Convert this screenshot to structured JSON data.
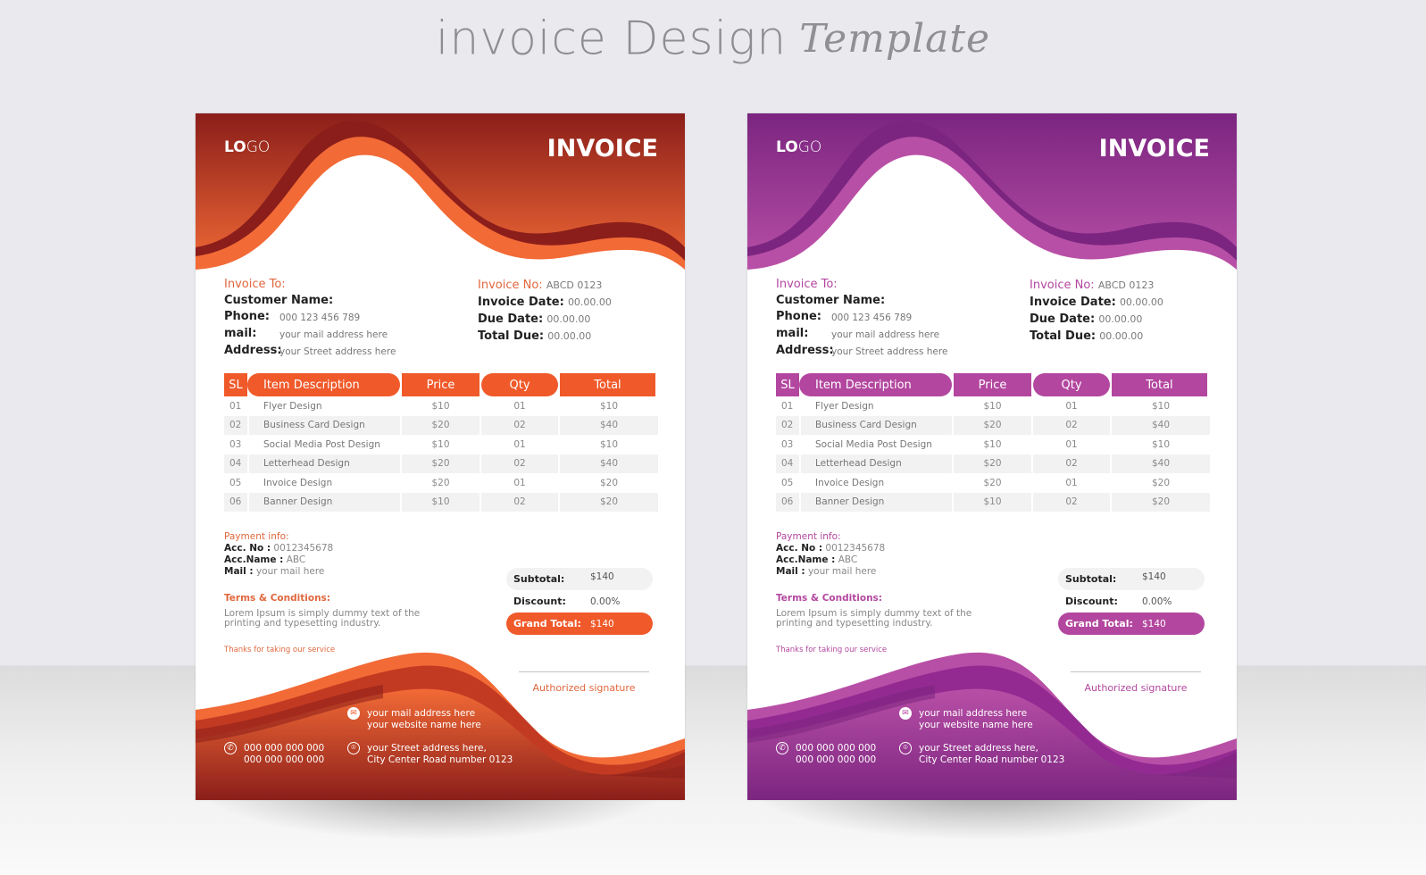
{
  "page_title": {
    "main": "invoice Design",
    "script": "Template"
  },
  "invoices": [
    {
      "theme": "orange",
      "colors": {
        "accent": "#f05a2a",
        "dark": "#8b1e1a",
        "mid": "#c33a22",
        "light": "#f26a36",
        "label": "#e0673d"
      },
      "logo": {
        "bold": "LO",
        "light": "GO"
      },
      "title": "INVOICE",
      "bill_to": {
        "header": "Invoice To:",
        "customer_label": "Customer Name:",
        "phone_label": "Phone:",
        "phone_value": "000 123 456 789",
        "mail_label": "mail:",
        "mail_value": "your mail address here",
        "address_label": "Address:",
        "address_value": "your Street address here"
      },
      "meta": {
        "invoice_no_label": "Invoice No:",
        "invoice_no_value": "ABCD 0123",
        "invoice_date_label": "Invoice Date:",
        "invoice_date_value": "00.00.00",
        "due_date_label": "Due Date:",
        "due_date_value": "00.00.00",
        "total_due_label": "Total Due:",
        "total_due_value": "00.00.00"
      },
      "table": {
        "headers": [
          "SL",
          "Item Description",
          "Price",
          "Qty",
          "Total"
        ],
        "rows": [
          [
            "01",
            "Flyer Design",
            "$10",
            "01",
            "$10"
          ],
          [
            "02",
            "Business Card Design",
            "$20",
            "02",
            "$40"
          ],
          [
            "03",
            "Social Media Post Design",
            "$10",
            "01",
            "$10"
          ],
          [
            "04",
            "Letterhead Design",
            "$20",
            "02",
            "$40"
          ],
          [
            "05",
            "Invoice Design",
            "$20",
            "01",
            "$20"
          ],
          [
            "06",
            "Banner Design",
            "$10",
            "02",
            "$20"
          ]
        ]
      },
      "payment": {
        "header": "Payment info:",
        "acc_no_label": "Acc. No :",
        "acc_no_value": "0012345678",
        "acc_name_label": "Acc.Name :",
        "acc_name_value": "ABC",
        "mail_label": "Mail :",
        "mail_value": "your mail here"
      },
      "terms": {
        "header": "Terms & Conditions:",
        "body": "Lorem Ipsum is simply dummy text of the printing and typesetting industry."
      },
      "thanks": "Thanks for taking our service",
      "totals": {
        "subtotal_label": "Subtotal:",
        "subtotal_value": "$140",
        "discount_label": "Discount:",
        "discount_value": "0.00%",
        "grand_label": "Grand Total:",
        "grand_value": "$140"
      },
      "signature": "Authorized signature",
      "footer": {
        "mail": "your mail address here",
        "website": "your website name here",
        "phone1": "000 000 000 000",
        "phone2": "000 000 000 000",
        "address1": "your Street address here,",
        "address2": "City Center Road number 0123"
      }
    },
    {
      "theme": "purple",
      "colors": {
        "accent": "#b3479f",
        "dark": "#7b2580",
        "mid": "#932a92",
        "light": "#b84fa6",
        "label": "#b3479f"
      },
      "logo": {
        "bold": "LO",
        "light": "GO"
      },
      "title": "INVOICE",
      "bill_to": {
        "header": "Invoice To:",
        "customer_label": "Customer Name:",
        "phone_label": "Phone:",
        "phone_value": "000 123 456 789",
        "mail_label": "mail:",
        "mail_value": "your mail address here",
        "address_label": "Address:",
        "address_value": "your Street address here"
      },
      "meta": {
        "invoice_no_label": "Invoice No:",
        "invoice_no_value": "ABCD 0123",
        "invoice_date_label": "Invoice Date:",
        "invoice_date_value": "00.00.00",
        "due_date_label": "Due Date:",
        "due_date_value": "00.00.00",
        "total_due_label": "Total Due:",
        "total_due_value": "00.00.00"
      },
      "table": {
        "headers": [
          "SL",
          "Item Description",
          "Price",
          "Qty",
          "Total"
        ],
        "rows": [
          [
            "01",
            "Flyer Design",
            "$10",
            "01",
            "$10"
          ],
          [
            "02",
            "Business Card Design",
            "$20",
            "02",
            "$40"
          ],
          [
            "03",
            "Social Media Post Design",
            "$10",
            "01",
            "$10"
          ],
          [
            "04",
            "Letterhead Design",
            "$20",
            "02",
            "$40"
          ],
          [
            "05",
            "Invoice Design",
            "$20",
            "01",
            "$20"
          ],
          [
            "06",
            "Banner Design",
            "$10",
            "02",
            "$20"
          ]
        ]
      },
      "payment": {
        "header": "Payment info:",
        "acc_no_label": "Acc. No :",
        "acc_no_value": "0012345678",
        "acc_name_label": "Acc.Name :",
        "acc_name_value": "ABC",
        "mail_label": "Mail :",
        "mail_value": "your mail here"
      },
      "terms": {
        "header": "Terms & Conditions:",
        "body": "Lorem Ipsum is simply dummy text of the printing and typesetting industry."
      },
      "thanks": "Thanks for taking our service",
      "totals": {
        "subtotal_label": "Subtotal:",
        "subtotal_value": "$140",
        "discount_label": "Discount:",
        "discount_value": "0.00%",
        "grand_label": "Grand Total:",
        "grand_value": "$140"
      },
      "signature": "Authorized signature",
      "footer": {
        "mail": "your mail address here",
        "website": "your website name here",
        "phone1": "000 000 000 000",
        "phone2": "000 000 000 000",
        "address1": "your Street address here,",
        "address2": "City Center Road number 0123"
      }
    }
  ]
}
